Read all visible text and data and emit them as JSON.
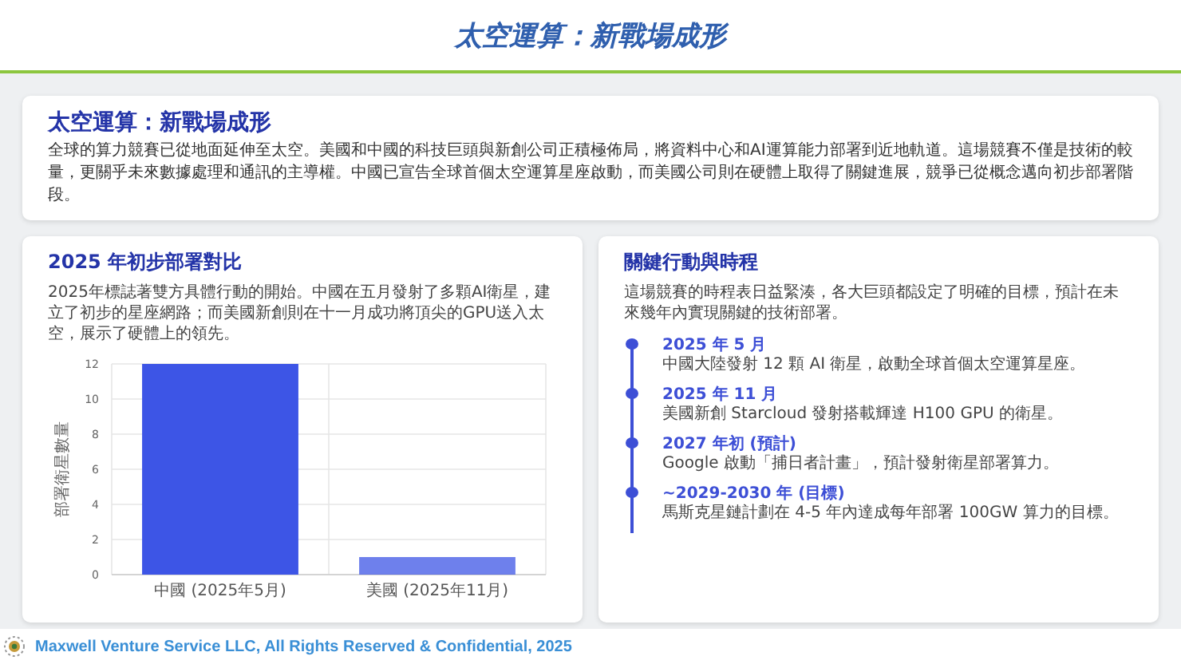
{
  "header": {
    "title": "太空運算：新戰場成形"
  },
  "intro": {
    "title": "太空運算：新戰場成形",
    "text": "全球的算力競賽已從地面延伸至太空。美國和中國的科技巨頭與新創公司正積極佈局，將資料中心和AI運算能力部署到近地軌道。這場競賽不僅是技術的較量，更關乎未來數據處理和通訊的主導權。中國已宣告全球首個太空運算星座啟動，而美國公司則在硬體上取得了關鍵進展，競爭已從概念邁向初步部署階段。"
  },
  "comparison": {
    "title": "2025 年初步部署對比",
    "text": "2025年標誌著雙方具體行動的開始。中國在五月發射了多顆AI衛星，建立了初步的星座網路；而美國新創則在十一月成功將頂尖的GPU送入太空，展示了硬體上的領先。",
    "chart_data": {
      "type": "bar",
      "ylabel": "部署衛星數量",
      "categories": [
        "中國 (2025年5月)",
        "美國 (2025年11月)"
      ],
      "series": [
        {
          "color": "#3d55e6",
          "values": [
            12,
            1
          ]
        }
      ],
      "grid": true,
      "ylim": [
        0,
        12
      ],
      "yticks": [
        0,
        2,
        4,
        6,
        8,
        10,
        12
      ]
    }
  },
  "timeline": {
    "title": "關鍵行動與時程",
    "text": "這場競賽的時程表日益緊湊，各大巨頭都設定了明確的目標，預計在未來幾年內實現關鍵的技術部署。",
    "events": [
      {
        "date": "2025 年 5 月",
        "text": "中國大陸發射 12 顆 AI 衛星，啟動全球首個太空運算星座。"
      },
      {
        "date": "2025 年 11 月",
        "text": "美國新創 Starcloud 發射搭載輝達 H100 GPU 的衛星。"
      },
      {
        "date": "2027 年初 (預計)",
        "text": "Google 啟動「捕日者計畫」，預計發射衛星部署算力。"
      },
      {
        "date": "~2029-2030 年 (目標)",
        "text": "馬斯克星鏈計劃在 4-5 年內達成每年部署 100GW 算力的目標。"
      }
    ]
  },
  "footer": {
    "text": "Maxwell Venture Service LLC, All Rights Reserved & Confidential, 2025"
  }
}
